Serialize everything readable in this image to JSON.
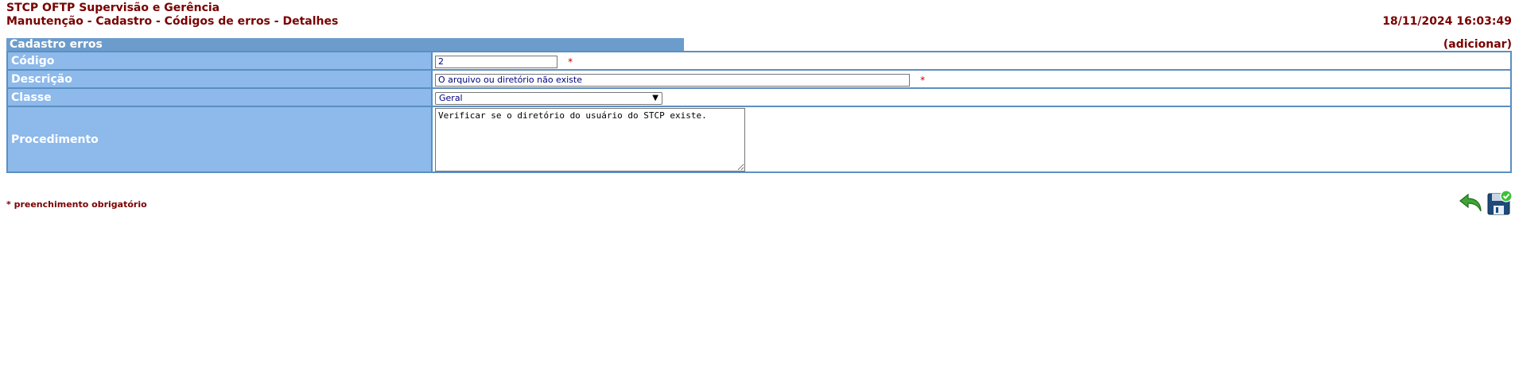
{
  "header": {
    "app_title": "STCP OFTP Supervisão e Gerência",
    "breadcrumb": "Manutenção - Cadastro - Códigos de erros - Detalhes",
    "datetime": "18/11/2024 16:03:49"
  },
  "section": {
    "title": "Cadastro erros",
    "add_link": "(adicionar)"
  },
  "form": {
    "codigo": {
      "label": "Código",
      "value": "2",
      "required_mark": "*"
    },
    "descricao": {
      "label": "Descrição",
      "value": "O arquivo ou diretório não existe",
      "required_mark": "*"
    },
    "classe": {
      "label": "Classe",
      "selected": "Geral"
    },
    "procedimento": {
      "label": "Procedimento",
      "value": "Verificar se o diretório do usuário do STCP existe."
    }
  },
  "footer": {
    "required_note": "* preenchimento obrigatório"
  },
  "icons": {
    "back": "back-arrow-icon",
    "save": "save-disk-icon"
  },
  "colors": {
    "accent_text": "#7a0000",
    "section_bar": "#6c9ccc",
    "label_bg": "#8db9eb",
    "border": "#5b8fc1",
    "back_icon": "#3fa535",
    "save_icon": "#1d4a7a"
  }
}
